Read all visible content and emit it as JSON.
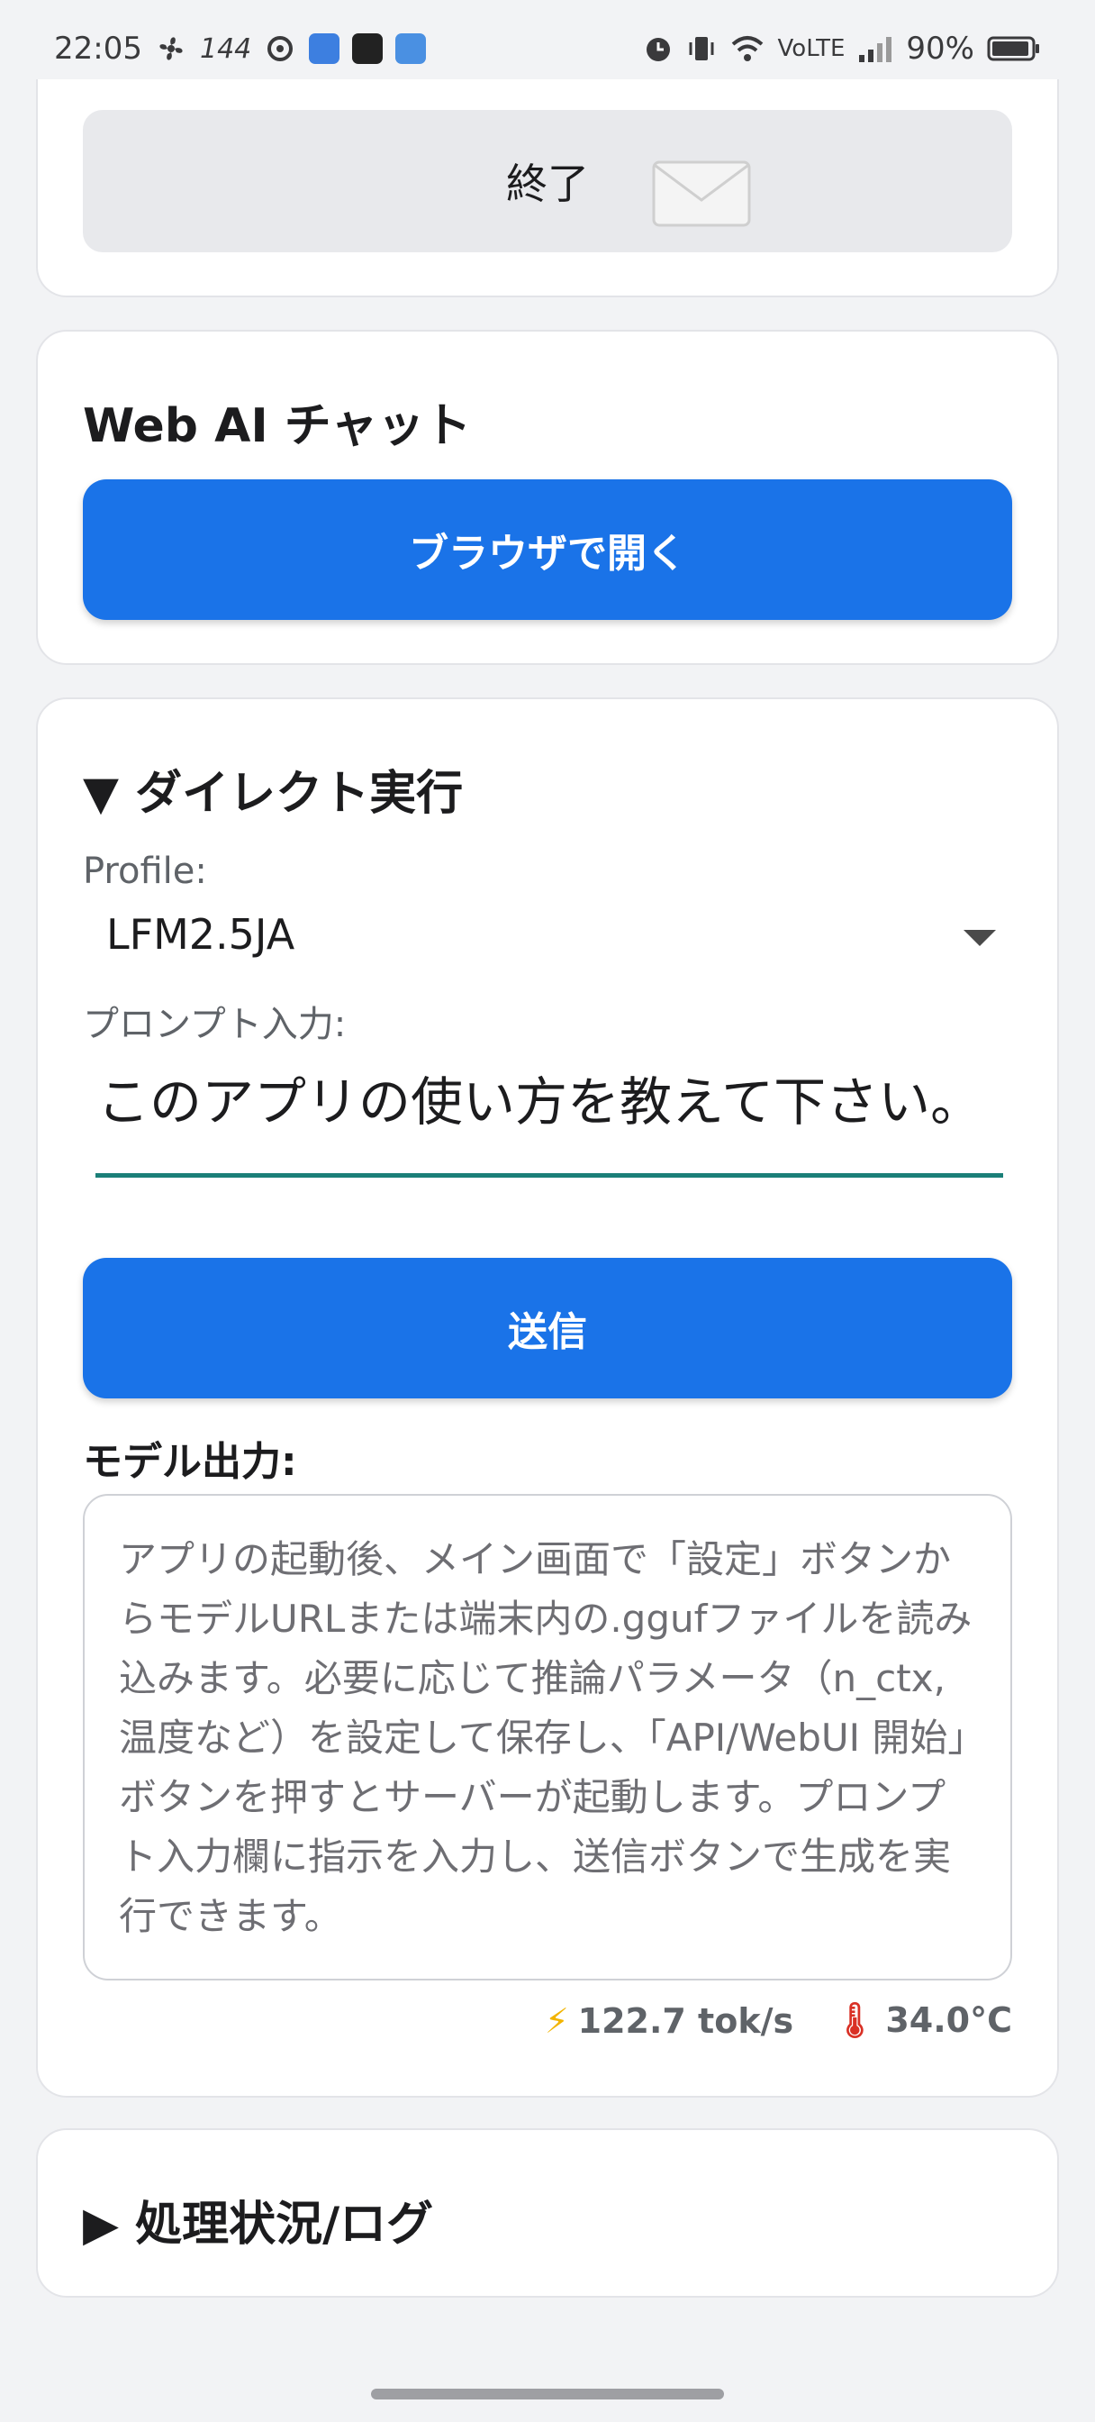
{
  "status_bar": {
    "time": "22:05",
    "refresh_rate": "144",
    "network": "VoLTE",
    "battery": "90%",
    "icons": [
      "fan-icon",
      "refresh-rate-icon",
      "sync-icon",
      "app-notification-icon",
      "tiktok-icon",
      "cloud-icon",
      "alarm-icon",
      "vibrate-icon",
      "wifi-icon",
      "signal-icon",
      "battery-icon"
    ]
  },
  "top_card": {
    "end_button_label": "終了"
  },
  "web_chat": {
    "title": "Web AI チャット",
    "open_browser_label": "ブラウザで開く"
  },
  "direct": {
    "title": "▼ ダイレクト実行",
    "profile_label": "Profile:",
    "profile_value": "LFM2.5JA",
    "prompt_label": "プロンプト入力:",
    "prompt_value": "このアプリの使い方を教えて下さい。",
    "send_label": "送信",
    "output_label": "モデル出力:",
    "output_text": "アプリの起動後、メイン画面で「設定」ボタンからモデルURLまたは端末内の.ggufファイルを読み込みます。必要に応じて推論パラメータ（n_ctx, 温度など）を設定して保存し、「API/WebUI 開始」ボタンを押すとサーバーが起動します。プロンプト入力欄に指示を入力し、送信ボタンで生成を実行できます。",
    "speed": "122.7 tok/s",
    "temperature": "34.0°C"
  },
  "log_section": {
    "title": "▶ 処理状況/ログ"
  },
  "colors": {
    "accent": "#1a73e8",
    "underline": "#1a7f78",
    "background": "#f2f3f5"
  }
}
